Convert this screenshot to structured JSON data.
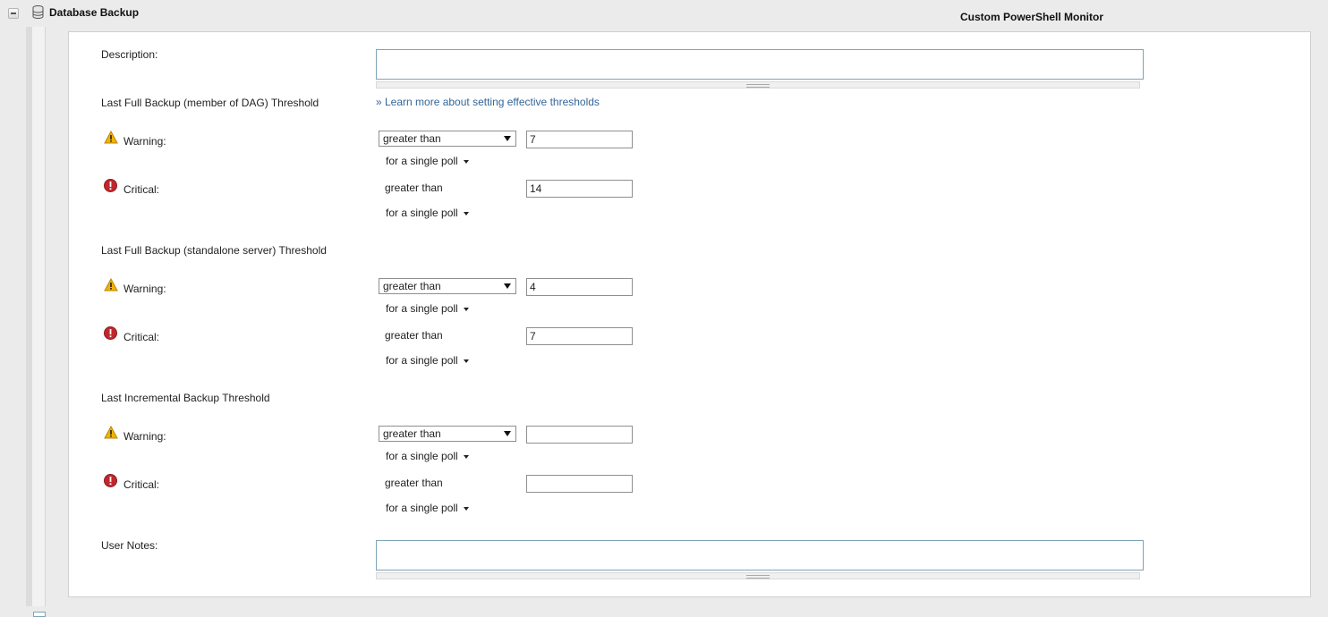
{
  "section": {
    "title": "Database Backup",
    "monitor_type": "Custom PowerShell Monitor"
  },
  "form": {
    "description_label": "Description:",
    "learn_more": "» Learn more about setting effective thresholds",
    "user_notes_label": "User Notes:",
    "thresholds": [
      {
        "title": "Last Full Backup (member of DAG) Threshold",
        "warning_label": "Warning:",
        "warning_operator": "greater than",
        "warning_value": "7",
        "warning_poll": "for  a single poll",
        "critical_label": "Critical:",
        "critical_operator": "greater than",
        "critical_value": "14",
        "critical_poll": "for  a single poll"
      },
      {
        "title": "Last Full Backup (standalone server) Threshold",
        "warning_label": "Warning:",
        "warning_operator": "greater than",
        "warning_value": "4",
        "warning_poll": "for  a single poll",
        "critical_label": "Critical:",
        "critical_operator": "greater than",
        "critical_value": "7",
        "critical_poll": "for  a single poll"
      },
      {
        "title": "Last Incremental Backup Threshold",
        "warning_label": "Warning:",
        "warning_operator": "greater than",
        "warning_value": "",
        "warning_poll": "for  a single poll",
        "critical_label": "Critical:",
        "critical_operator": "greater than",
        "critical_value": "",
        "critical_poll": "for  a single poll"
      }
    ]
  },
  "colors": {
    "link": "#336699",
    "warning": "#f0b400",
    "critical": "#c0282d",
    "input_border": "#7fa3b8"
  },
  "icons": {
    "warning": "warning-triangle-icon",
    "critical": "critical-exclamation-icon",
    "database": "database-icon"
  }
}
